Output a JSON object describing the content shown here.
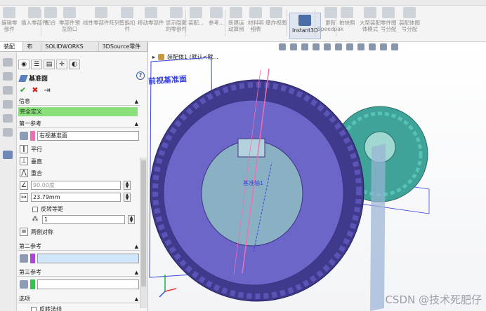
{
  "ribbon": {
    "buttons": [
      {
        "label": "编辑零\n部件",
        "left": 0
      },
      {
        "label": "插入零部件",
        "left": 0
      },
      {
        "label": "配合",
        "left": 0
      },
      {
        "label": "零部件预\n览窗口",
        "left": 0
      },
      {
        "label": "线性零部件阵列",
        "left": 0
      },
      {
        "label": "智能扣\n件",
        "left": 0
      },
      {
        "label": "移动零部件",
        "left": 0
      },
      {
        "label": "显示隐藏\n的零部件",
        "left": 0
      },
      {
        "label": "装配...",
        "left": 0
      },
      {
        "label": "参考...",
        "left": 0
      },
      {
        "label": "新建运\n动算例",
        "left": 0
      },
      {
        "label": "材料明\n细表",
        "left": 0
      },
      {
        "label": "爆炸视图",
        "left": 0
      },
      {
        "label": "Instant3D",
        "left": 0
      },
      {
        "label": "更新\nSpeedpak",
        "left": 0
      },
      {
        "label": "拍快照",
        "left": 0
      },
      {
        "label": "大型装配\n体模式",
        "left": 0
      },
      {
        "label": "零件图\n号分配",
        "left": 0
      },
      {
        "label": "装配体图\n号分配",
        "left": 0
      }
    ]
  },
  "tabs": [
    "装配体",
    "布局",
    "SOLIDWORKS MBD",
    "3DSource零件库"
  ],
  "pm": {
    "title": "基准面",
    "info_header": "信息",
    "message": "完全定义",
    "first_ref_header": "第一参考",
    "first_ref_value": "右视基准面",
    "constraints": {
      "parallel": "平行",
      "perpendicular": "垂直",
      "coincident": "重合",
      "angle": "90.00度",
      "distance": "23.79mm",
      "flip_offset": "反转等距",
      "count": "1",
      "mid_plane": "两侧对称"
    },
    "second_ref_header": "第二参考",
    "second_ref_value": "",
    "third_ref_header": "第三参考",
    "third_ref_value": "",
    "options_header": "选项",
    "flip_normal": "反转法线"
  },
  "viewport": {
    "breadcrumb": "装配体1 (默认<默...",
    "plane_label": "前视基准面",
    "axis_label": "基准轴1",
    "watermark": "CSDN @技术死肥仔"
  },
  "colors": {
    "gear_large": "#4c46a0",
    "gear_small": "#3fa39a",
    "message_bg": "#8ae07b",
    "first_ref_swatch": "#f06fb4",
    "second_ref_swatch": "#b043e0",
    "third_ref_swatch": "#2ec84a",
    "plane_line": "#3a44e0"
  }
}
